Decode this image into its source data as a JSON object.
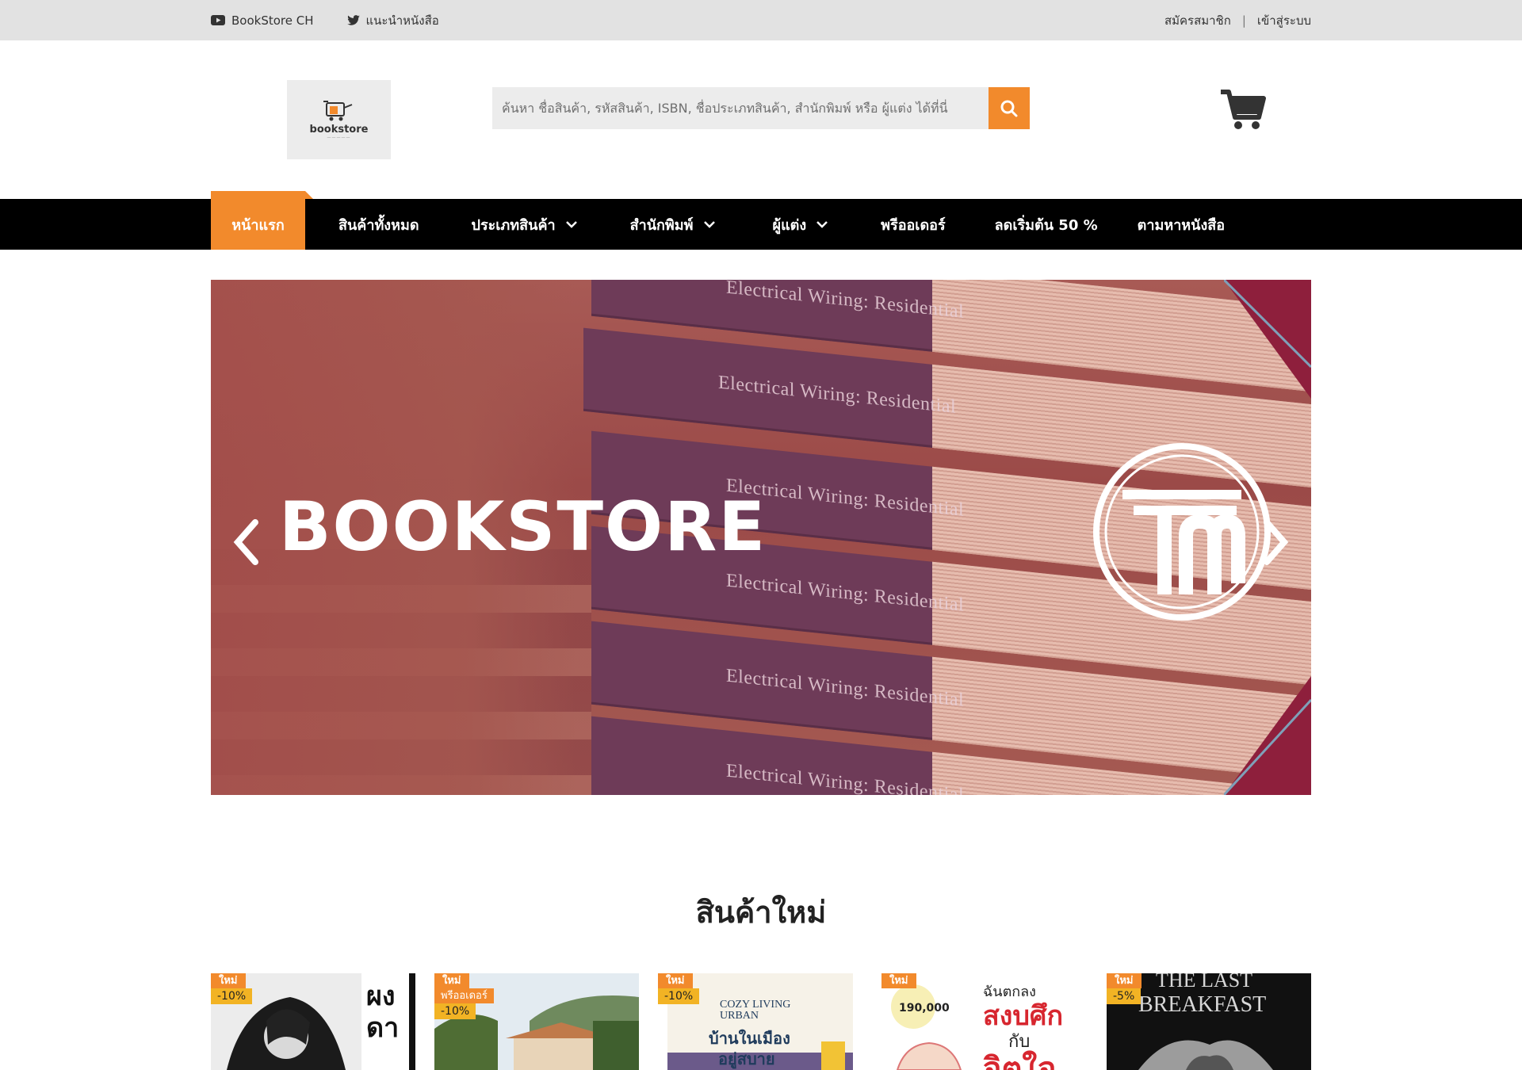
{
  "topbar": {
    "youtube_label": "BookStore CH",
    "twitter_label": "แนะนำหนังสือ",
    "register": "สมัครสมาชิก",
    "separator": "|",
    "login": "เข้าสู่ระบบ"
  },
  "header": {
    "logo_text": "bookstore",
    "search_placeholder": "ค้นหา ชื่อสินค้า, รหัสสินค้า, ISBN, ชื่อประเภทสินค้า, สำนักพิมพ์ หรือ ผู้แต่ง ได้ที่นี่"
  },
  "nav": {
    "items": [
      {
        "label": "หน้าแรก"
      },
      {
        "label": "สินค้าทั้งหมด"
      },
      {
        "label": "ประเภทสินค้า"
      },
      {
        "label": "สำนักพิมพ์"
      },
      {
        "label": "ผู้แต่ง"
      },
      {
        "label": "พรีออเดอร์"
      },
      {
        "label": "ลดเริ่มต้น 50 %"
      },
      {
        "label": "ตามหาหนังสือ"
      }
    ]
  },
  "banner": {
    "brand": "BOOKSTORE",
    "book_title": "Electrical Wiring: Residential"
  },
  "section": {
    "title": "สินค้าใหม่"
  },
  "products": [
    {
      "badge": "ใหม่",
      "preorder": "",
      "discount": "-10%"
    },
    {
      "badge": "ใหม่",
      "preorder": "พรีออเดอร์",
      "discount": "-10%"
    },
    {
      "badge": "ใหม่",
      "preorder": "",
      "discount": "-10%",
      "cover_line1": "COZY LIVING",
      "cover_line2": "URBAN",
      "cover_line3": "บ้านในเมือง",
      "cover_line4": "อยู่สบาย"
    },
    {
      "badge": "ใหม่",
      "preorder": "",
      "discount": "",
      "cover_line1": "ฉันตกลง",
      "cover_line2": "สงบศึก",
      "cover_line3": "กับ",
      "cover_line4": "จิตใจ",
      "sold": "190,000"
    },
    {
      "badge": "ใหม่",
      "preorder": "",
      "discount": "-5%",
      "cover_line1": "THE LAST",
      "cover_line2": "BREAKFAST"
    }
  ],
  "colors": {
    "accent": "#f28a2c",
    "discount": "#f2b324",
    "navbar": "#000000",
    "topbar": "#e2e2e2"
  }
}
